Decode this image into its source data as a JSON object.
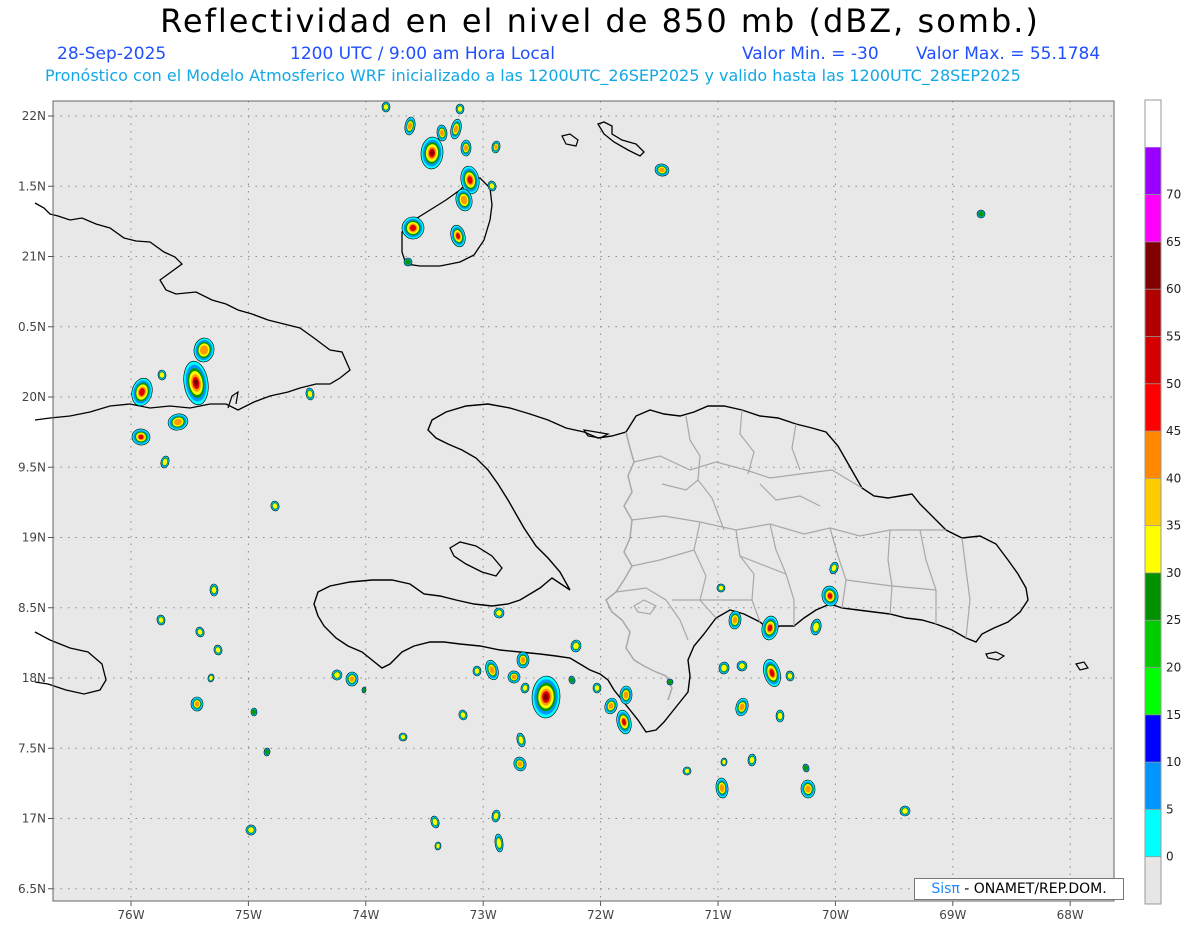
{
  "header": {
    "title": "Reflectividad en el nivel de 850 mb (dBZ, somb.)",
    "date": "28-Sep-2025",
    "time_label": "1200 UTC / 9:00 am Hora Local",
    "min_label": "Valor Min. = -30",
    "max_label": "Valor Max. = 55.1784",
    "description": "Pronóstico con el Modelo Atmosferico WRF inicializado a las 1200UTC_26SEP2025 y valido hasta las 1200UTC_28SEP2025"
  },
  "map": {
    "lon_ticks": [
      "76W",
      "75W",
      "74W",
      "73W",
      "72W",
      "71W",
      "70W",
      "69W",
      "68W"
    ],
    "lat_ticks": [
      "22N",
      "1.5N",
      "21N",
      "0.5N",
      "20N",
      "9.5N",
      "19N",
      "8.5N",
      "18N",
      "7.5N",
      "17N",
      "6.5N"
    ],
    "lon_values": [
      -76,
      -75,
      -74,
      -73,
      -72,
      -71,
      -70,
      -69,
      -68
    ],
    "lat_values": [
      22,
      21.5,
      21,
      20.5,
      20,
      19.5,
      19,
      18.5,
      18,
      17.5,
      17,
      16.5
    ],
    "background_color": "#e8e8e8",
    "grid": "dotted"
  },
  "colorbar": {
    "labels": [
      "0",
      "5",
      "10",
      "15",
      "20",
      "25",
      "30",
      "35",
      "40",
      "45",
      "50",
      "55",
      "60",
      "65",
      "70"
    ],
    "colors": [
      "#e6e6e6",
      "#00ffff",
      "#0095ff",
      "#0000ff",
      "#00ff00",
      "#00cc00",
      "#009000",
      "#ffff00",
      "#ffcc00",
      "#ff8800",
      "#ff0000",
      "#d40000",
      "#b00000",
      "#800000",
      "#ff00ff",
      "#9900ff",
      "#ffffff"
    ]
  },
  "credit": {
    "logo": "Sisπ",
    "text": "- ONAMET/REP.DOM."
  }
}
